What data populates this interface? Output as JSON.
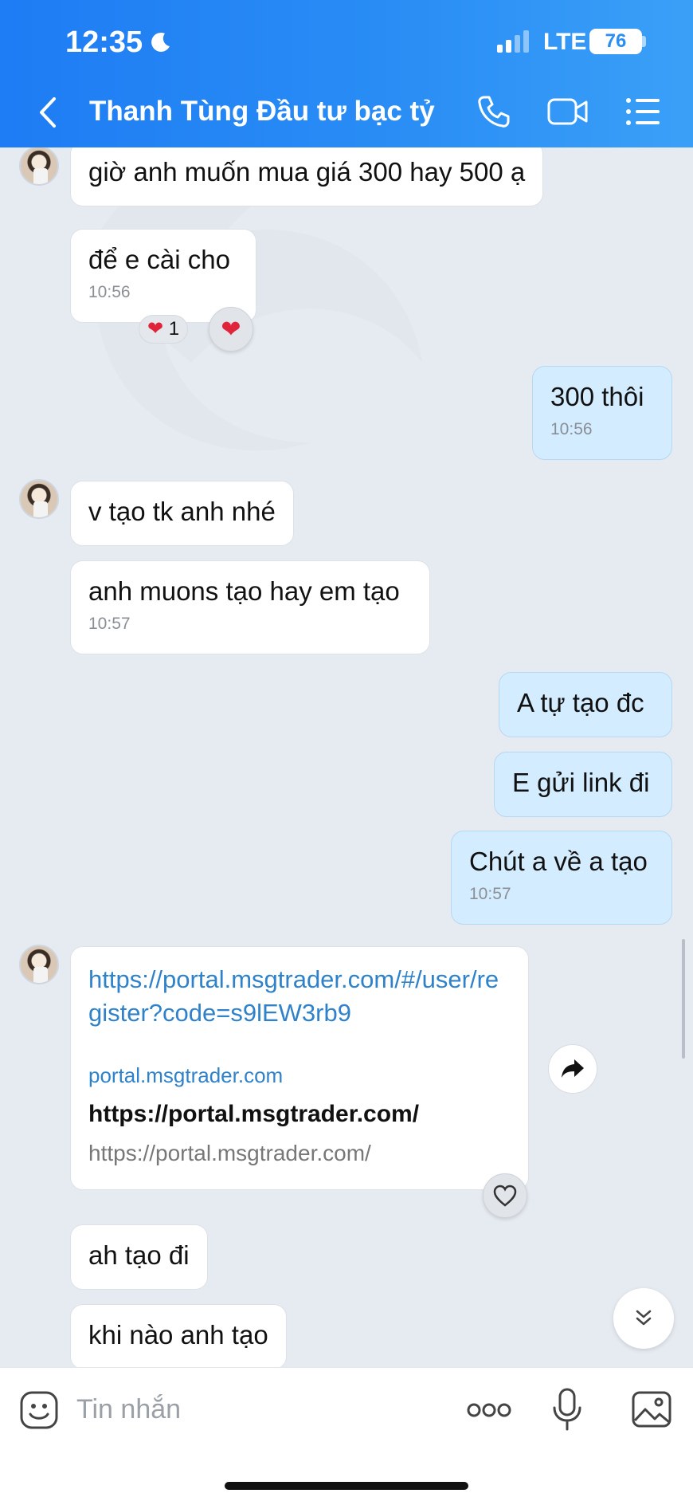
{
  "status_bar": {
    "time": "12:35",
    "network": "LTE",
    "battery": "76"
  },
  "header": {
    "title": "Thanh Tùng Đầu tư bạc tỷ"
  },
  "messages": [
    {
      "text": "giờ anh muốn mua giá 300 hay 500 ạ"
    },
    {
      "text": "để e cài cho",
      "time": "10:56",
      "reaction_count": "1"
    },
    {
      "text": "300 thôi",
      "time": "10:56"
    },
    {
      "text": "v tạo tk anh nhé"
    },
    {
      "text": "anh muons tạo hay em tạo",
      "time": "10:57"
    },
    {
      "text": "A tự tạo đc"
    },
    {
      "text": "E gửi link đi"
    },
    {
      "text": "Chút a về a tạo",
      "time": "10:57"
    },
    {
      "text": "ah tạo đi"
    },
    {
      "text": "khi nào anh tạo"
    }
  ],
  "link_card": {
    "url": "https://portal.msgtrader.com/#/user/register?code=s9lEW3rb9",
    "domain": "portal.msgtrader.com",
    "title": "https://portal.msgtrader.com/",
    "subtitle": "https://portal.msgtrader.com/"
  },
  "input": {
    "placeholder": "Tin nhắn"
  },
  "colors": {
    "header": "#2a8ef5",
    "outgoing_bubble": "#d4ecff",
    "link": "#2f82c9"
  },
  "icons": [
    "back-icon",
    "phone-icon",
    "video-icon",
    "menu-icon",
    "heart-icon",
    "share-icon",
    "chevron-down-icon",
    "emoji-icon",
    "more-icon",
    "mic-icon",
    "image-icon"
  ]
}
